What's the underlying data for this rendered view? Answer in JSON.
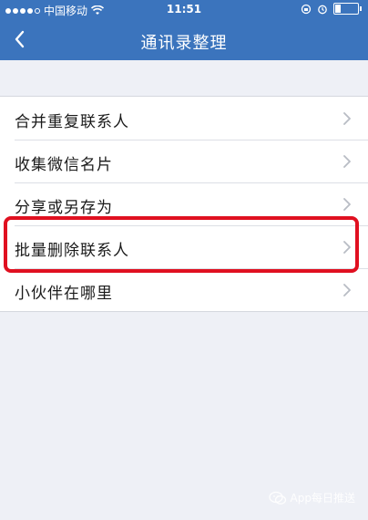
{
  "status_bar": {
    "carrier": "中国移动",
    "time": "11:51"
  },
  "nav": {
    "title": "通讯录整理",
    "back_icon": "chevron-left-icon"
  },
  "menu": {
    "items": [
      {
        "label": "合并重复联系人",
        "icon": "chevron-right-icon"
      },
      {
        "label": "收集微信名片",
        "icon": "chevron-right-icon"
      },
      {
        "label": "分享或另存为",
        "icon": "chevron-right-icon"
      },
      {
        "label": "批量删除联系人",
        "icon": "chevron-right-icon"
      },
      {
        "label": "小伙伴在哪里",
        "icon": "chevron-right-icon"
      }
    ]
  },
  "highlight_color": "#e01020",
  "theme_color": "#3b74bd",
  "watermark": {
    "text": "App每日推送"
  }
}
